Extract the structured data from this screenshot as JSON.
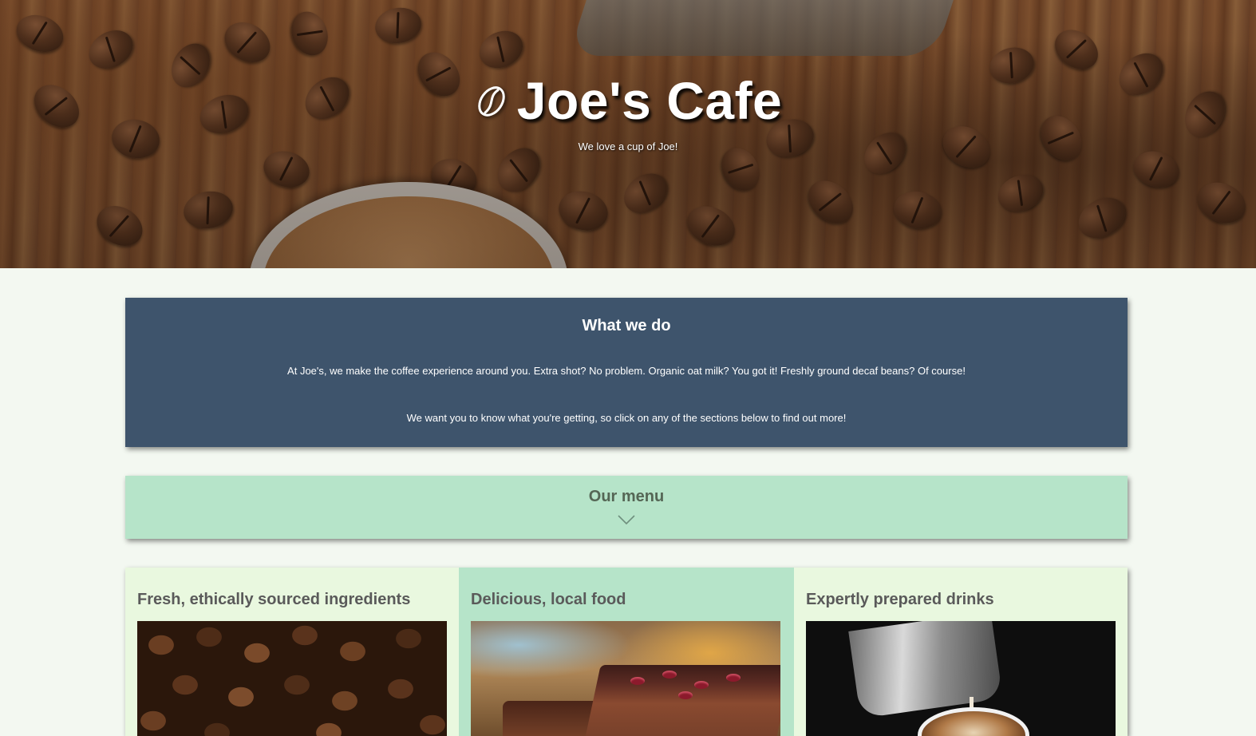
{
  "hero": {
    "title": "Joe's Cafe",
    "subtitle": "We love a cup of Joe!",
    "logo_icon": "coffee-bean-icon"
  },
  "about": {
    "heading": "What we do",
    "paragraph_1": "At Joe's, we make the coffee experience around you. Extra shot? No problem. Organic oat milk? You got it! Freshly ground decaf beans? Of course!",
    "paragraph_2": "We want you to know what you're getting, so click on any of the sections below to find out more!"
  },
  "menu_toggle": {
    "label": "Our menu",
    "icon": "chevron-down-icon"
  },
  "features": [
    {
      "title": "Fresh, ethically sourced ingredients",
      "image": "coffee-beans-photo"
    },
    {
      "title": "Delicious, local food",
      "image": "cake-photo"
    },
    {
      "title": "Expertly prepared drinks",
      "image": "latte-photo"
    }
  ],
  "colors": {
    "page_background": "#f3f8f1",
    "about_background": "#3e546c",
    "menu_background": "#b6e4c9",
    "card_light": "#e9f8df",
    "card_mid": "#b6e4c9",
    "heading_gray": "#5a5a5a"
  }
}
